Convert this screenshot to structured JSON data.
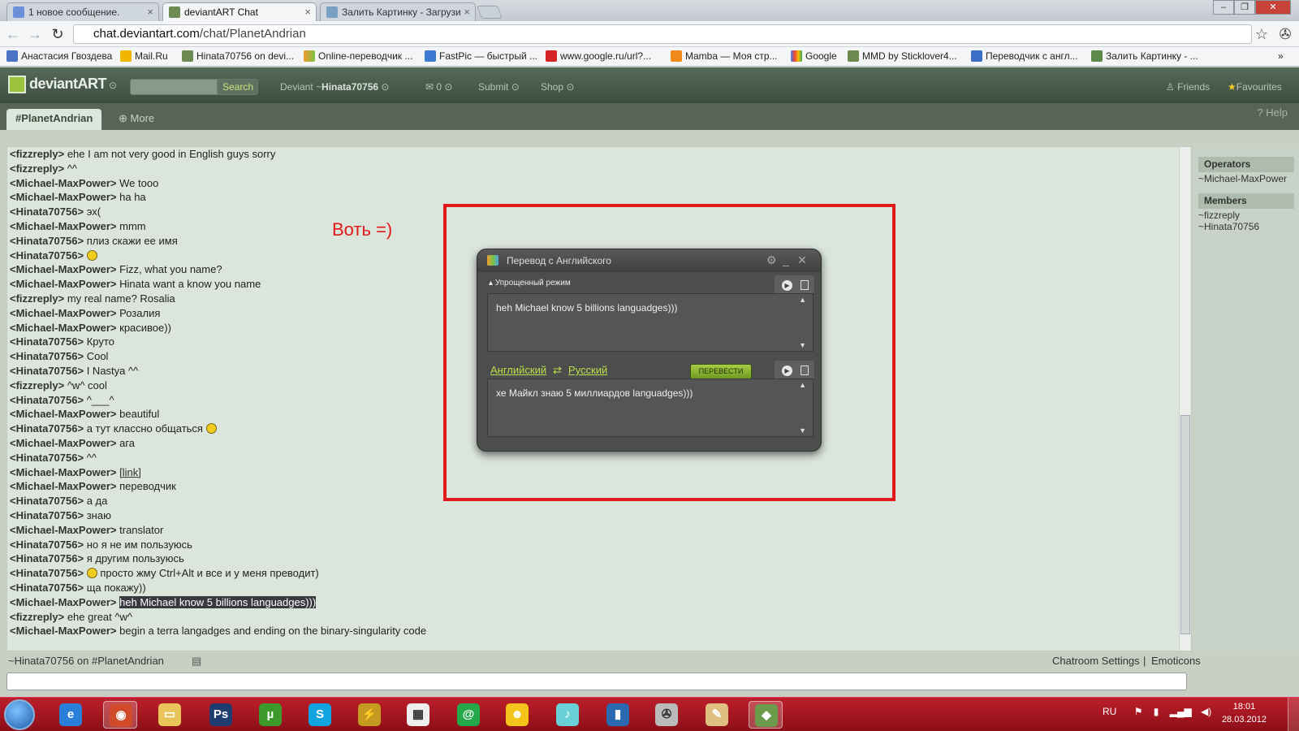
{
  "browser": {
    "tabs": [
      {
        "label": "1 новое сообщение.",
        "icon": "mailru-icon"
      },
      {
        "label": "deviantART Chat",
        "icon": "deviantart-icon"
      },
      {
        "label": "Залить Картинку - Загрузи",
        "icon": "fastpic-icon"
      }
    ],
    "url_domain": "chat.deviantart.com",
    "url_path": "/chat/PlanetAndrian",
    "bookmarks": [
      "Анастасия Гвоздева",
      "Mail.Ru",
      "Hinata70756 on devi...",
      "Online-переводчик ...",
      "FastPic — быстрый ...",
      "www.google.ru/url?...",
      "Mamba — Моя стр...",
      "Google",
      "MMD by Sticklover4...",
      "Переводчик с англ...",
      "Залить Картинку - ..."
    ]
  },
  "da": {
    "logo_dev": "deviant",
    "logo_art": "ART",
    "search_label": "Search",
    "deviant_label": "Deviant ~",
    "username": "Hinata70756",
    "mail_count": "0",
    "submit_label": "Submit",
    "shop_label": "Shop",
    "friends_label": "Friends",
    "favourites_label": "Favourites",
    "channel_tab": "#PlanetAndrian",
    "more_label": "More",
    "help_label": "Help"
  },
  "chat": {
    "messages": [
      {
        "nick": "<fizzreply>",
        "text": "ehe I am not very good in English guys sorry"
      },
      {
        "nick": "<fizzreply>",
        "text": "^^"
      },
      {
        "nick": "<Michael-MaxPower>",
        "text": "We tooo"
      },
      {
        "nick": "<Michael-MaxPower>",
        "text": "ha ha"
      },
      {
        "nick": "<Hinata70756>",
        "text": "эх("
      },
      {
        "nick": "<Michael-MaxPower>",
        "text": "mmm"
      },
      {
        "nick": "<Hinata70756>",
        "text": "плиз скажи ее имя"
      },
      {
        "nick": "<Hinata70756>",
        "text": ""
      },
      {
        "nick": "<Michael-MaxPower>",
        "text": "Fizz, what you name?"
      },
      {
        "nick": "<Michael-MaxPower>",
        "text": "Hinata want a know you name"
      },
      {
        "nick": "<fizzreply>",
        "text": "my real name? Rosalia"
      },
      {
        "nick": "<Michael-MaxPower>",
        "text": "Розалия"
      },
      {
        "nick": "<Michael-MaxPower>",
        "text": "красивое))"
      },
      {
        "nick": "<Hinata70756>",
        "text": "Круто"
      },
      {
        "nick": "<Hinata70756>",
        "text": "Cool"
      },
      {
        "nick": "<Hinata70756>",
        "text": "I Nastya ^^"
      },
      {
        "nick": "<fizzreply>",
        "text": "^w^ cool"
      },
      {
        "nick": "<Hinata70756>",
        "text": "^___^"
      },
      {
        "nick": "<Michael-MaxPower>",
        "text": "beautiful"
      },
      {
        "nick": "<Hinata70756>",
        "text": "а тут классно общаться"
      },
      {
        "nick": "<Michael-MaxPower>",
        "text": "ага"
      },
      {
        "nick": "<Hinata70756>",
        "text": "^^"
      },
      {
        "nick": "<Michael-MaxPower>",
        "text": "[link]"
      },
      {
        "nick": "<Michael-MaxPower>",
        "text": "переводчик"
      },
      {
        "nick": "<Hinata70756>",
        "text": "а да"
      },
      {
        "nick": "<Hinata70756>",
        "text": "знаю"
      },
      {
        "nick": "<Michael-MaxPower>",
        "text": "translator"
      },
      {
        "nick": "<Hinata70756>",
        "text": "но я не им пользуюсь"
      },
      {
        "nick": "<Hinata70756>",
        "text": "я другим пользуюсь"
      },
      {
        "nick": "<Hinata70756>",
        "text": "просто жму Ctrl+Alt и все и у меня преводит)"
      },
      {
        "nick": "<Hinata70756>",
        "text": "ща покажу))"
      },
      {
        "nick": "<Michael-MaxPower>",
        "text": "heh Michael know 5 billions languadges)))"
      },
      {
        "nick": "<fizzreply>",
        "text": "ehe great ^w^"
      },
      {
        "nick": "<Michael-MaxPower>",
        "text": "begin a terra langadges and ending on the binary-singularity code"
      }
    ],
    "status_line": "~Hinata70756 on #PlanetAndrian",
    "chatroom_settings": "Chatroom Settings",
    "separator": "|",
    "emoticons": "Emoticons",
    "input_value": ""
  },
  "sidebar": {
    "operators_title": "Operators",
    "operators": [
      "~Michael-MaxPower"
    ],
    "members_title": "Members",
    "members": [
      "~fizzreply",
      "~Hinata70756"
    ]
  },
  "annotation": {
    "text": "Воть =)",
    "color": "#e01a1a"
  },
  "translator": {
    "title": "Перевод с Английского",
    "mode": "Упрощенный режим",
    "source_text": "heh Michael know 5 billions languadges)))",
    "lang_from": "Английский",
    "swap": "⇄",
    "lang_to": "Русский",
    "translate_button": "ПЕРЕВЕСТИ",
    "result_text": "хе Майкл знаю 5 миллиардов languadges)))"
  },
  "taskbar": {
    "apps": [
      "internet-explorer-icon",
      "chrome-icon",
      "explorer-icon",
      "photoshop-icon",
      "utorrent-icon",
      "skype-icon",
      "winamp-icon",
      "calendar-icon",
      "mail-agent-icon",
      "yellow-face-icon",
      "miku-icon",
      "jacket-icon",
      "media-icon",
      "paint-icon",
      "translator-icon"
    ],
    "lang": "RU",
    "time": "18:01",
    "date": "28.03.2012"
  }
}
